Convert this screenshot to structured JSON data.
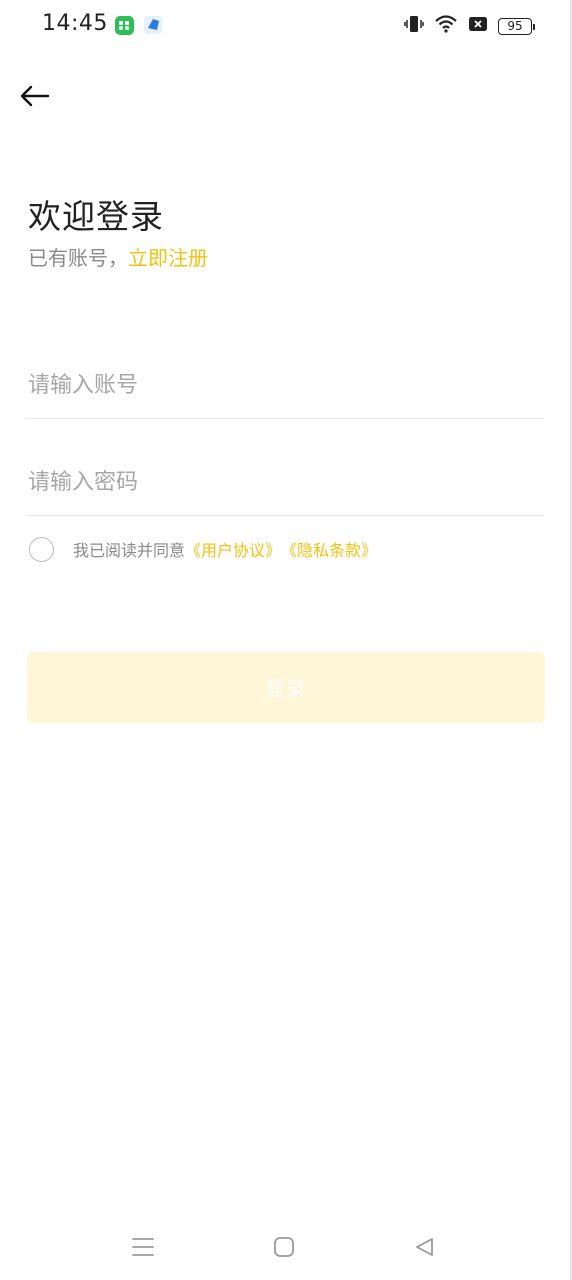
{
  "status_bar": {
    "time": "14:45",
    "battery_level": "95",
    "icons": [
      "app-green-icon",
      "app-blue-icon",
      "vibrate-icon",
      "wifi-icon",
      "sim-x-icon",
      "battery-icon"
    ]
  },
  "header": {
    "back_icon": "arrow-left-icon"
  },
  "login": {
    "title": "欢迎登录",
    "subtitle_prefix": "已有账号，",
    "register_link": "立即注册",
    "account_placeholder": "请输入账号",
    "password_placeholder": "请输入密码",
    "agree_text": "我已阅读并同意",
    "user_agreement": "《用户协议》",
    "privacy_policy": "《隐私条款》",
    "login_button": "登录"
  },
  "colors": {
    "accent": "#f3c20f",
    "button_bg": "#fff6d8",
    "muted_text": "#8a8a8a"
  },
  "nav_bar": {
    "icons": [
      "menu-icon",
      "home-square-icon",
      "back-triangle-icon"
    ]
  }
}
